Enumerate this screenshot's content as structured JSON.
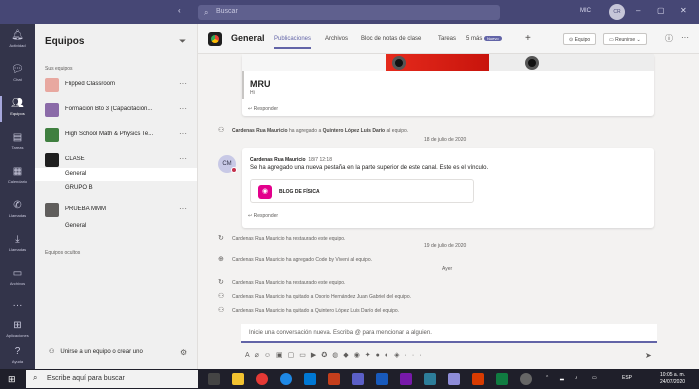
{
  "titlebar": {
    "search_placeholder": "Buscar",
    "user_label": "MIC",
    "avatar_initials": "CR"
  },
  "rail": [
    {
      "label": "Actividad",
      "icon": "bell-icon"
    },
    {
      "label": "Chat",
      "icon": "chat-icon"
    },
    {
      "label": "Equipos",
      "icon": "teams-icon"
    },
    {
      "label": "Tareas",
      "icon": "assignments-icon"
    },
    {
      "label": "Calendario",
      "icon": "calendar-icon"
    },
    {
      "label": "Llamadas",
      "icon": "phone-icon"
    },
    {
      "label": "Llamadas",
      "icon": "download-icon"
    },
    {
      "label": "Archivos",
      "icon": "files-icon"
    },
    {
      "label": "Aplicaciones",
      "icon": "apps-icon"
    },
    {
      "label": "Ayuda",
      "icon": "help-icon"
    }
  ],
  "panel": {
    "title": "Equipos",
    "your_teams": "Sus equipos",
    "teams": [
      {
        "name": "Flipped Classroom",
        "color": "#e8a8a0"
      },
      {
        "name": "Formación Bto 3 (Capacitación...",
        "color": "#8b6ba8"
      },
      {
        "name": "High School Math & Physics Te...",
        "color": "#3f7f3f"
      },
      {
        "name": "CLASE",
        "color": "#1f1f1f"
      },
      {
        "name": "PRUEBA MMM",
        "color": "#605e5c"
      }
    ],
    "channels_clase": [
      "General",
      "GRUPO B"
    ],
    "channels_prueba": [
      "General"
    ],
    "hidden_teams": "Equipos ocultos",
    "join_label": "Unirse a un equipo o crear uno"
  },
  "channel": {
    "name": "General",
    "tabs": [
      "Publicaciones",
      "Archivos",
      "Bloc de notas de clase",
      "Tareas",
      "5 más"
    ],
    "badge": "Nuevo",
    "team_btn": "Equipo",
    "meet_btn": "Reunirse"
  },
  "feed": {
    "mru_title": "MRU",
    "mru_sub": "Hi",
    "reply": "Responder",
    "sys1_name": "Cardenas Rua Mauricio",
    "sys1_text": " ha agregado a ",
    "sys1_target": "Quintero López Luis Darío",
    "sys1_end": " al equipo.",
    "date1": "18 de julio de 2020",
    "post_avatar": "CM",
    "post_author": "Cardenas Rua Mauricio",
    "post_time": "18/7 12:18",
    "post_body": "Se ha agregado una nueva pestaña en la parte superior de este canal. Este es el vínculo.",
    "tab_card_label": "BLOG DE FÍSICA",
    "restored1": "Cardenas Rua Mauricio ha restaurado este equipo.",
    "date2": "19 de julio de 2020",
    "added_code": "Cardenas Rua Mauricio ha agregado Code by Viveni al equipo.",
    "date3": "Ayer",
    "restored2": "Cardenas Rua Mauricio ha restaurado este equipo.",
    "removed1": "Cardenas Rua Mauricio ha quitado a Osorio Hernández Juan Gabriel del equipo.",
    "removed2": "Cardenas Rua Mauricio ha quitado a Quintero López Luis Darío del equipo."
  },
  "compose": {
    "placeholder": "Inicie una conversación nueva. Escriba @ para mencionar a alguien."
  },
  "taskbar": {
    "search_placeholder": "Escribe aquí para buscar",
    "lang": "ESP",
    "time": "10:05 a. m.",
    "date": "24/07/2020"
  }
}
